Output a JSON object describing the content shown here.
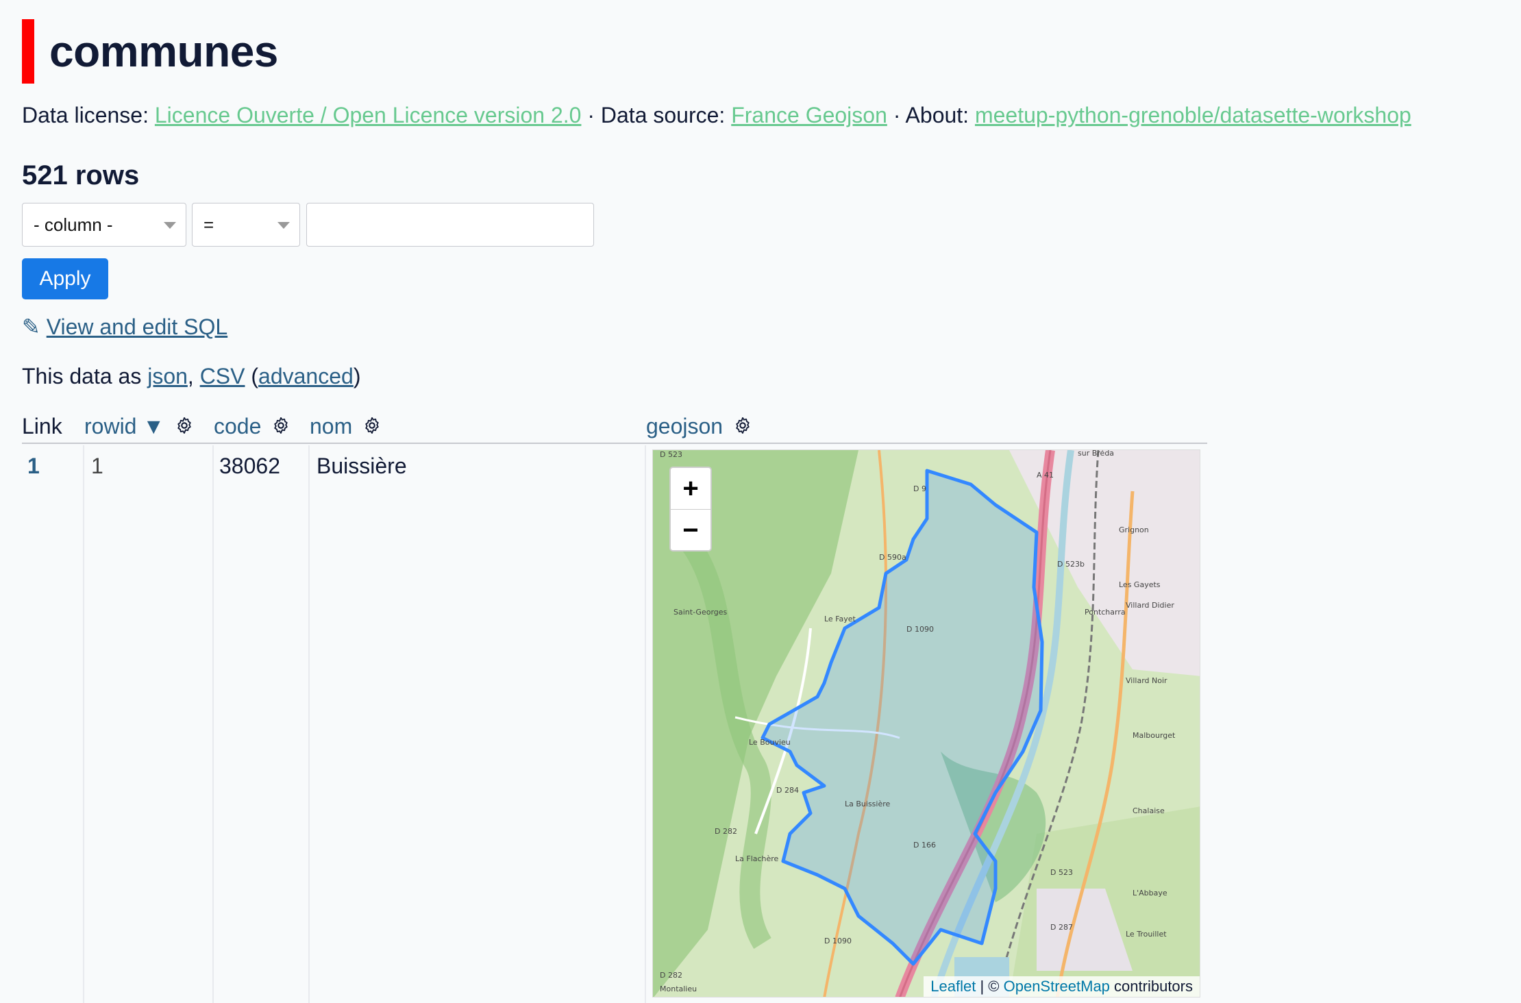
{
  "header": {
    "title": "communes",
    "accent_color": "#ff0000"
  },
  "meta": {
    "license_label": "Data license:",
    "license_link": "Licence Ouverte / Open Licence version 2.0",
    "sep1": "·",
    "source_label": "Data source:",
    "source_link": "France Geojson",
    "sep2": "·",
    "about_label": "About:",
    "about_link": "meetup-python-grenoble/datasette-workshop"
  },
  "row_count": "521 rows",
  "filter": {
    "column_value": "- column -",
    "op_value": "=",
    "text_value": ""
  },
  "apply_label": "Apply",
  "sql_link": {
    "icon": "✎",
    "label": "View and edit SQL"
  },
  "export": {
    "prefix": "This data as",
    "json": "json",
    "comma": ",",
    "csv": "CSV",
    "open": "(",
    "advanced": "advanced",
    "close": ")"
  },
  "table": {
    "columns": {
      "link": "Link",
      "rowid": "rowid",
      "sort_arrow": "▼",
      "code": "code",
      "nom": "nom",
      "geojson": "geojson"
    },
    "rows": [
      {
        "link": "1",
        "rowid": "1",
        "code": "38062",
        "nom": "Buissière"
      }
    ]
  },
  "map": {
    "zoom_in": "+",
    "zoom_out": "−",
    "attribution_leaflet": "Leaflet",
    "attribution_sep": "| ©",
    "attribution_osm": "OpenStreetMap",
    "attribution_suffix": "contributors",
    "labels": [
      "A 41",
      "D 9",
      "D 590a",
      "D 523b",
      "Grignon",
      "Les Gayets",
      "Villard Didier",
      "Saint-Georges",
      "Le Fayet",
      "D 1090",
      "Villard Noir",
      "Malbourget",
      "Le Bouvieu",
      "La Buissière",
      "D 284",
      "D 282",
      "Chalaise",
      "La Flachère",
      "D 166",
      "D 523",
      "D 287",
      "L'Abbaye",
      "Le Trouillet",
      "D 1090",
      "Montalieu",
      "Pontcharra",
      "sur Bréda",
      "D 282",
      "D 523"
    ]
  }
}
